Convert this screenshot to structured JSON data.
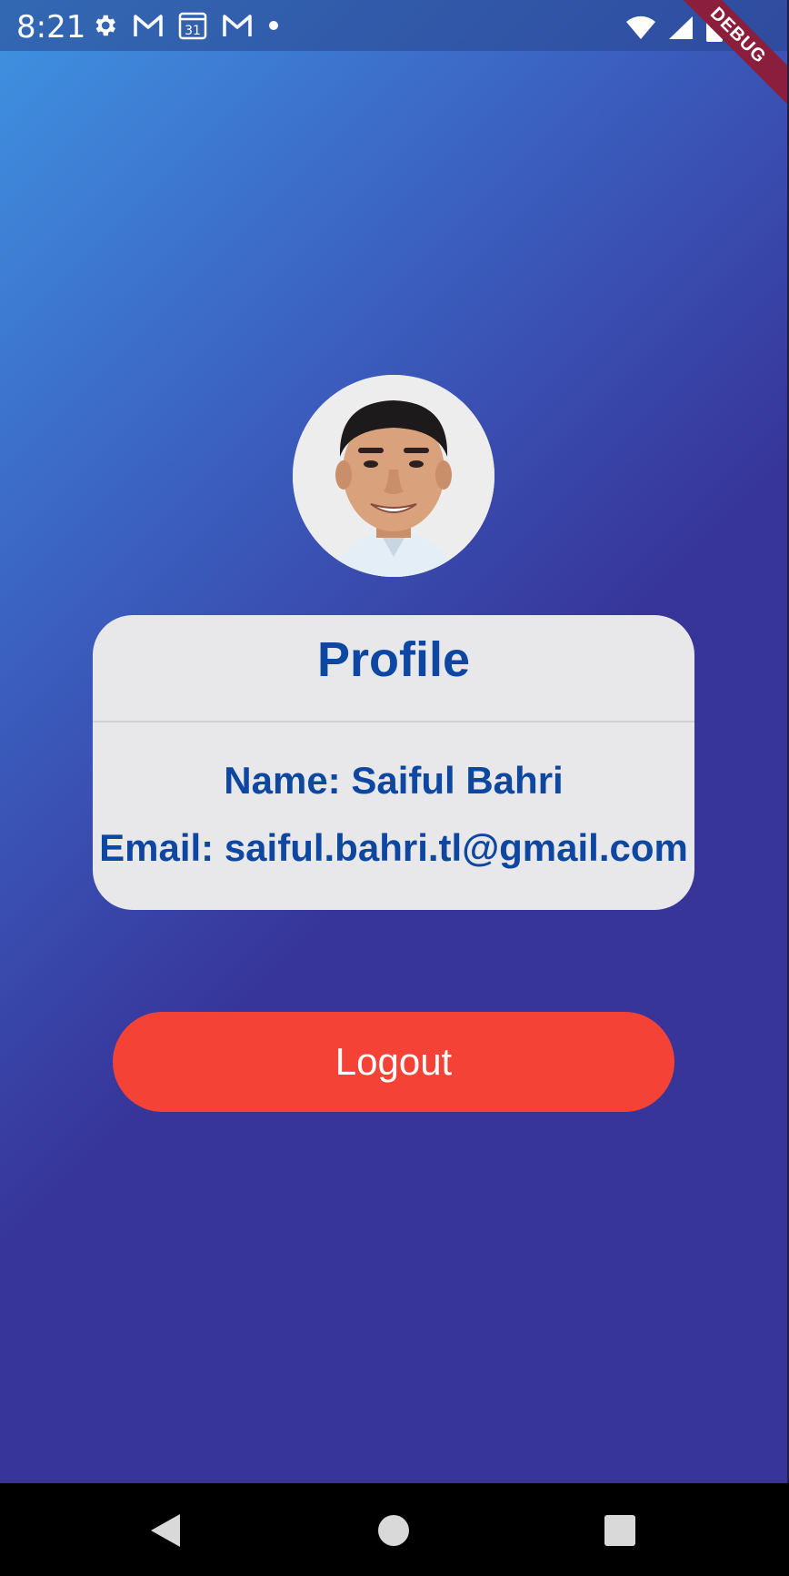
{
  "status_bar": {
    "time": "8:21",
    "left_icons": [
      "gear-icon",
      "gmail-icon",
      "calendar-icon",
      "gmail-icon",
      "dot-icon"
    ],
    "calendar_day": "31",
    "right_icons": [
      "wifi-icon",
      "signal-icon",
      "battery-icon"
    ]
  },
  "debug_banner": {
    "label": "DEBUG",
    "color": "#8b1e3c"
  },
  "profile": {
    "avatar_alt": "profile-photo",
    "title": "Profile",
    "name_line": "Name: Saiful Bahri",
    "email_line": "Email: saiful.bahri.tl@gmail.com"
  },
  "actions": {
    "logout_label": "Logout",
    "logout_color": "#f44336"
  },
  "nav_bar": {
    "buttons": [
      "back-icon",
      "home-icon",
      "recents-icon"
    ]
  },
  "colors": {
    "accent_text": "#0d47a1",
    "gradient_start": "#3f93e2",
    "gradient_end": "#37349a",
    "card_background": "#e8e8ea"
  }
}
